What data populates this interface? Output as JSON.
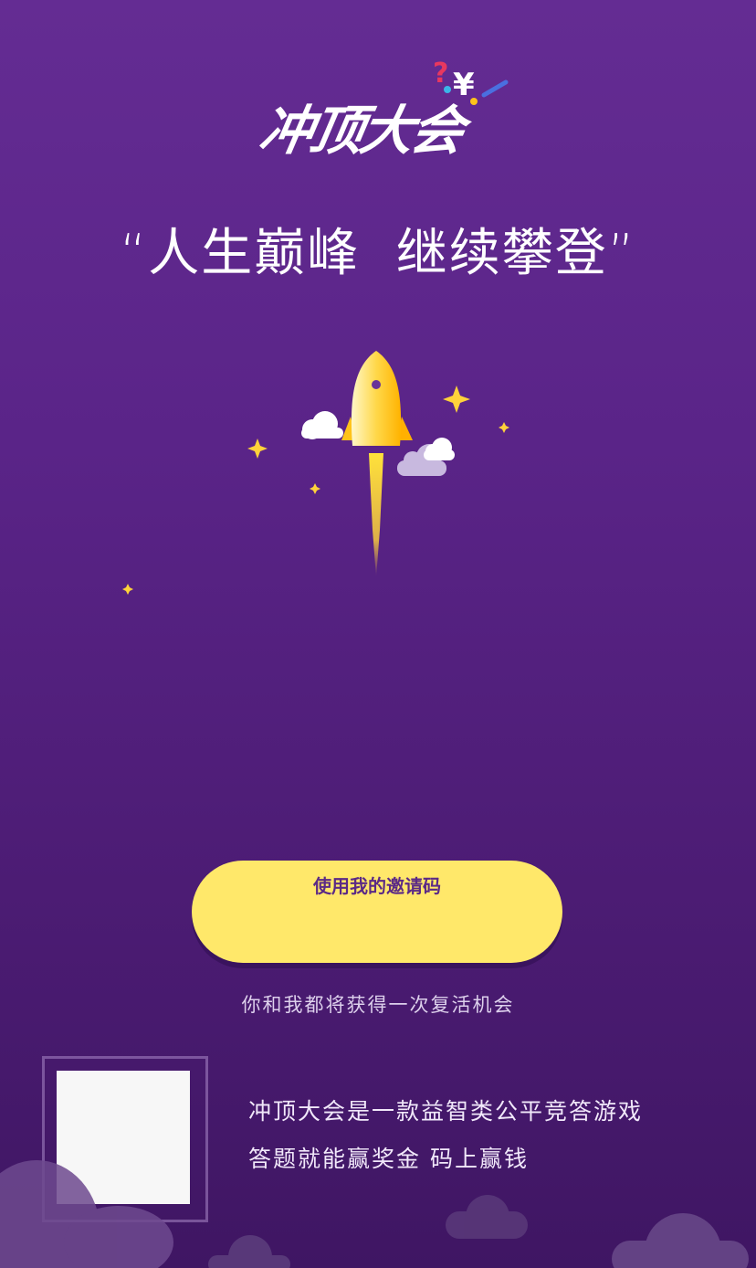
{
  "logo": {
    "text": "冲顶大会"
  },
  "slogan": "“人生巅峰  继续攀登”",
  "cta": {
    "label": "使用我的邀请码"
  },
  "note": "你和我都将获得一次复活机会",
  "description": {
    "line1": "冲顶大会是一款益智类公平竞答游戏",
    "line2": "答题就能赢奖金  码上赢钱"
  },
  "colors": {
    "background_top": "#642c93",
    "background_bottom": "#3f1663",
    "button": "#ffe86a",
    "rocket": "#ffc31a",
    "star": "#ffd23a"
  }
}
